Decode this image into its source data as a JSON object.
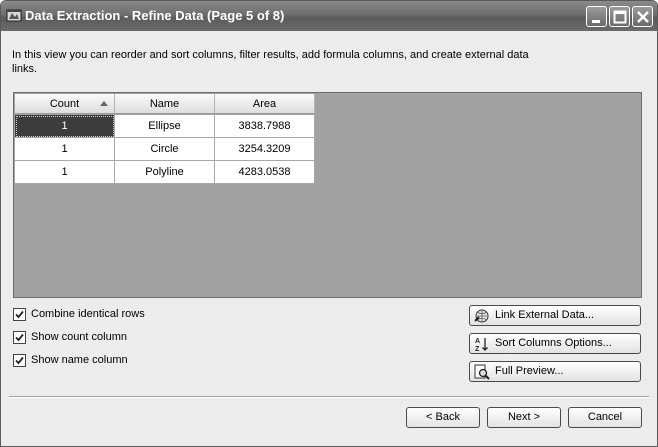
{
  "window": {
    "title": "Data Extraction - Refine Data (Page 5 of 8)"
  },
  "description": "In this view you can reorder and sort columns, filter results, add formula columns, and create external data links.",
  "table": {
    "columns": [
      "Count",
      "Name",
      "Area"
    ],
    "sorted_column": "Count",
    "rows": [
      [
        "1",
        "Ellipse",
        "3838.7988"
      ],
      [
        "1",
        "Circle",
        "3254.3209"
      ],
      [
        "1",
        "Polyline",
        "4283.0538"
      ]
    ]
  },
  "options": [
    {
      "label": "Combine identical rows",
      "checked": true
    },
    {
      "label": "Show count column",
      "checked": true
    },
    {
      "label": "Show name column",
      "checked": true
    }
  ],
  "actions": {
    "link_external": "Link External Data...",
    "sort_columns": "Sort Columns Options...",
    "full_preview": "Full Preview..."
  },
  "nav": {
    "back": "< Back",
    "next": "Next >",
    "cancel": "Cancel"
  },
  "icons": {
    "app": "app-icon",
    "link": "link-icon",
    "sort": "sort-az-icon",
    "preview": "magnifier-icon"
  }
}
